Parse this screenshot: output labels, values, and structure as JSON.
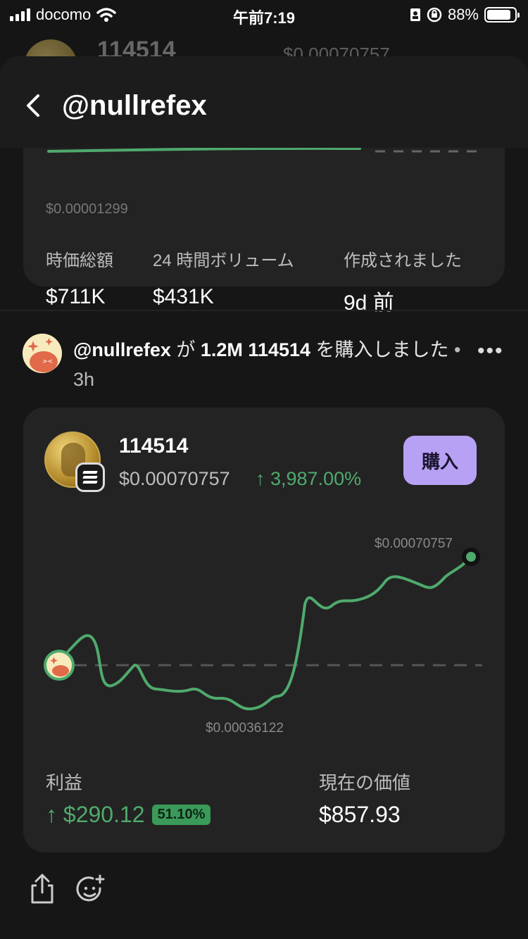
{
  "status_bar": {
    "carrier": "docomo",
    "time": "午前7:19",
    "battery": "88%",
    "battery_level": 0.88
  },
  "background": {
    "token_title": "114514",
    "token_price": "$0.00070757"
  },
  "header": {
    "back_icon": "chevron-left-icon",
    "title": "@nullrefex"
  },
  "stats": {
    "low_price": "$0.00001299",
    "items": [
      {
        "label": "時価総額",
        "value": "$711K"
      },
      {
        "label": "24 時間ボリューム",
        "value": "$431K"
      },
      {
        "label": "作成されました",
        "value": "9d 前"
      }
    ]
  },
  "post": {
    "user": "@nullrefex",
    "particle": " が ",
    "amount": "1.2M 114514",
    "action": " を購入しました",
    "separator": " • ",
    "time": "3h",
    "more_icon": "more-horizontal-icon"
  },
  "trade": {
    "token_name": "114514",
    "price": "$0.00070757",
    "change": "↑ 3,987.00%",
    "buy_label": "購入",
    "chart_high": "$0.00070757",
    "chart_low": "$0.00036122",
    "profit_label": "利益",
    "profit_value": "↑ $290.12",
    "profit_pct": "51.10%",
    "value_label": "現在の価値",
    "value": "$857.93",
    "colors": {
      "line": "#4faa6d",
      "buy": "#b7a1f4",
      "positive": "#4faa6d"
    }
  },
  "actions": {
    "share_icon": "share-icon",
    "emoji_icon": "add-reaction-icon"
  }
}
